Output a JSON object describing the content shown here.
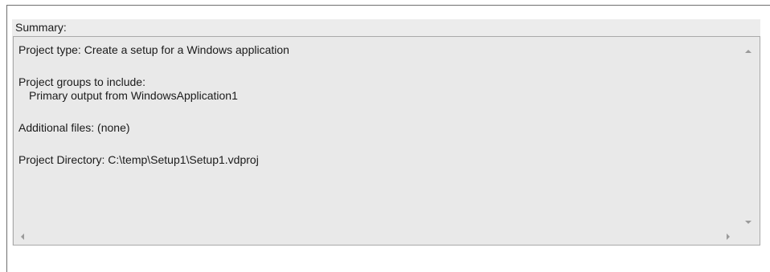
{
  "summary": {
    "label": "Summary:",
    "lines": {
      "project_type": "Project type: Create a setup for a Windows application",
      "groups_heading": "Project groups to include:",
      "group_item_1": "Primary output from WindowsApplication1",
      "additional_files": "Additional files: (none)",
      "project_directory": "Project Directory: C:\\temp\\Setup1\\Setup1.vdproj"
    }
  },
  "icons": {
    "scroll_up": "arrow-up-icon",
    "scroll_down": "arrow-down-icon",
    "scroll_left": "arrow-left-icon",
    "scroll_right": "arrow-right-icon"
  },
  "colors": {
    "panel_background": "#ececec",
    "textbox_background": "#e9e9e9",
    "text": "#1a1a1a"
  }
}
